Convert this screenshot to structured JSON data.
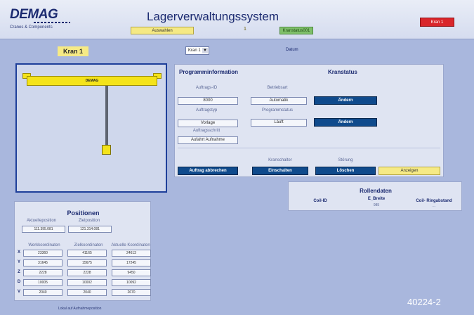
{
  "header": {
    "logo": "DEMAG",
    "logo_sub": "Cranes & Components",
    "title": "Lagerverwaltungssystem",
    "auswahl_button": "Auswahlen",
    "value": "1",
    "status": "Kranstatus001",
    "kran_button": "Kran 1"
  },
  "top": {
    "kran_title": "Kran 1",
    "kran_select": "Kran 1",
    "date_label": "Datum"
  },
  "crane_view": {
    "bridge_label": "DEMAG"
  },
  "programm": {
    "title": "Programminformation",
    "kranstatus_title": "Kranstatus",
    "auftrags_id_label": "Auftrags-ID",
    "auftrags_id_value": "8000",
    "betriebsart_label": "Betriebsart",
    "betriebsart_value": "Automatik",
    "aendern_1": "Ändern",
    "auftragstyp_label": "Auftragstyp",
    "auftragstyp_value": "Vorlage",
    "programmstatus_label": "Programmstatus",
    "programmstatus_value": "Läuft",
    "aendern_2": "Ändern",
    "auftragsschritt_label": "Auftragsschritt",
    "auftragsschritt_value": "Aufahrt Aufnahme",
    "kranschalter_label": "Kranschalter",
    "stoerung_label": "Störung",
    "abbrechen_button": "Auftrag abbrechen",
    "einschalten_button": "Einschalten",
    "loeschen_button": "Löschen",
    "anzeigen_button": "Anzeigen"
  },
  "rollendaten": {
    "title": "Rollendaten",
    "columns": [
      "Coil-ID",
      "E_Breite",
      "Coil- Ringabstand"
    ],
    "values": [
      "",
      "985",
      "..."
    ]
  },
  "positionen": {
    "title": "Positionen",
    "aktuelle_label": "Aktuelleposition",
    "aktuelle_value": "111.395.081",
    "zielposition_label": "Zielposition",
    "zielposition_value": "121.314.081",
    "col_headers": [
      "Werkkoordinaten",
      "Zielkoordinaten",
      "Aktuelle Koordinaten"
    ],
    "rows": [
      {
        "label": "X",
        "values": [
          "23360",
          "41165",
          "24613"
        ]
      },
      {
        "label": "Y",
        "values": [
          "31645",
          "15675",
          "17245"
        ]
      },
      {
        "label": "Z",
        "values": [
          "2228",
          "2228",
          "9450"
        ]
      },
      {
        "label": "D",
        "values": [
          "10005",
          "10002",
          "10092"
        ]
      },
      {
        "label": "V",
        "values": [
          "2040",
          "2040",
          "2670"
        ]
      }
    ],
    "footer": "Lokal auf Aufnahmeposition"
  },
  "watermark": "40224-2"
}
